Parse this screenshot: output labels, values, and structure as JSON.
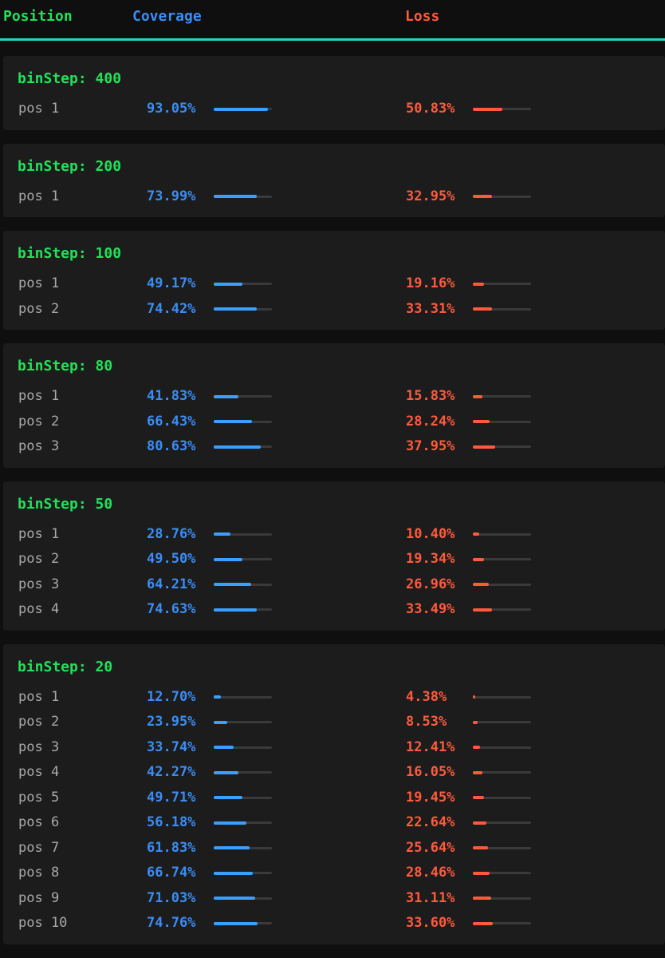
{
  "header": {
    "position_label": "Position",
    "coverage_label": "Coverage",
    "loss_label": "Loss"
  },
  "colors": {
    "accent_green": "#22e05a",
    "coverage_blue": "#3a8df5",
    "loss_red": "#ff5a3c",
    "header_rule": "#1fd8c4",
    "panel_bg": "#1c1c1c",
    "page_bg": "#0f0f0f"
  },
  "groups": [
    {
      "title": "binStep: 400",
      "rows": [
        {
          "pos": "pos 1",
          "coverage": "93.05%",
          "loss": "50.83%"
        }
      ]
    },
    {
      "title": "binStep: 200",
      "rows": [
        {
          "pos": "pos 1",
          "coverage": "73.99%",
          "loss": "32.95%"
        }
      ]
    },
    {
      "title": "binStep: 100",
      "rows": [
        {
          "pos": "pos 1",
          "coverage": "49.17%",
          "loss": "19.16%"
        },
        {
          "pos": "pos 2",
          "coverage": "74.42%",
          "loss": "33.31%"
        }
      ]
    },
    {
      "title": "binStep: 80",
      "rows": [
        {
          "pos": "pos 1",
          "coverage": "41.83%",
          "loss": "15.83%"
        },
        {
          "pos": "pos 2",
          "coverage": "66.43%",
          "loss": "28.24%"
        },
        {
          "pos": "pos 3",
          "coverage": "80.63%",
          "loss": "37.95%"
        }
      ]
    },
    {
      "title": "binStep: 50",
      "rows": [
        {
          "pos": "pos 1",
          "coverage": "28.76%",
          "loss": "10.40%"
        },
        {
          "pos": "pos 2",
          "coverage": "49.50%",
          "loss": "19.34%"
        },
        {
          "pos": "pos 3",
          "coverage": "64.21%",
          "loss": "26.96%"
        },
        {
          "pos": "pos 4",
          "coverage": "74.63%",
          "loss": "33.49%"
        }
      ]
    },
    {
      "title": "binStep: 20",
      "rows": [
        {
          "pos": "pos 1",
          "coverage": "12.70%",
          "loss": "4.38%"
        },
        {
          "pos": "pos 2",
          "coverage": "23.95%",
          "loss": "8.53%"
        },
        {
          "pos": "pos 3",
          "coverage": "33.74%",
          "loss": "12.41%"
        },
        {
          "pos": "pos 4",
          "coverage": "42.27%",
          "loss": "16.05%"
        },
        {
          "pos": "pos 5",
          "coverage": "49.71%",
          "loss": "19.45%"
        },
        {
          "pos": "pos 6",
          "coverage": "56.18%",
          "loss": "22.64%"
        },
        {
          "pos": "pos 7",
          "coverage": "61.83%",
          "loss": "25.64%"
        },
        {
          "pos": "pos 8",
          "coverage": "66.74%",
          "loss": "28.46%"
        },
        {
          "pos": "pos 9",
          "coverage": "71.03%",
          "loss": "31.11%"
        },
        {
          "pos": "pos 10",
          "coverage": "74.76%",
          "loss": "33.60%"
        }
      ]
    }
  ]
}
